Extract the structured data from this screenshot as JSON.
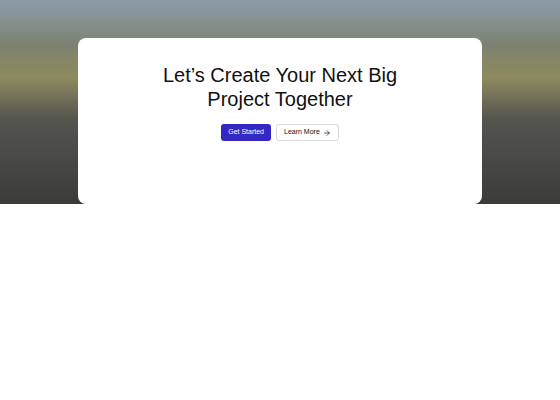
{
  "hero": {
    "heading": "Let’s Create Your Next Big Project Together",
    "primary_button": "Get Started",
    "secondary_button": "Learn More"
  }
}
